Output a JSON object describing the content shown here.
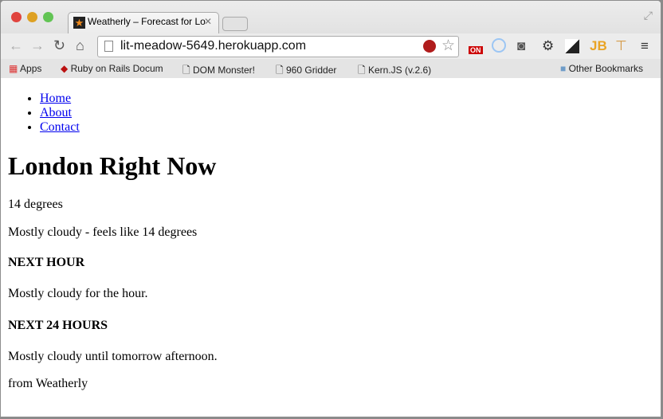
{
  "browser": {
    "tab_title": "Weatherly – Forecast for Lo",
    "url": "lit-meadow-5649.herokuapp.com",
    "bookmarks": [
      "Apps",
      "Ruby on Rails Docum",
      "DOM Monster!",
      "960 Gridder",
      "Kern.JS (v.2.6)"
    ],
    "other_bookmarks": "Other Bookmarks",
    "ext_badge": "ON"
  },
  "nav": [
    {
      "label": "Home"
    },
    {
      "label": "About"
    },
    {
      "label": "Contact"
    }
  ],
  "page": {
    "title": "London Right Now",
    "temperature": "14 degrees",
    "summary": "Mostly cloudy - feels like 14 degrees",
    "next_hour_heading": "NEXT HOUR",
    "next_hour": "Mostly cloudy for the hour.",
    "next_24_heading": "NEXT 24 HOURS",
    "next_24": "Mostly cloudy until tomorrow afternoon.",
    "footer": "from Weatherly"
  }
}
